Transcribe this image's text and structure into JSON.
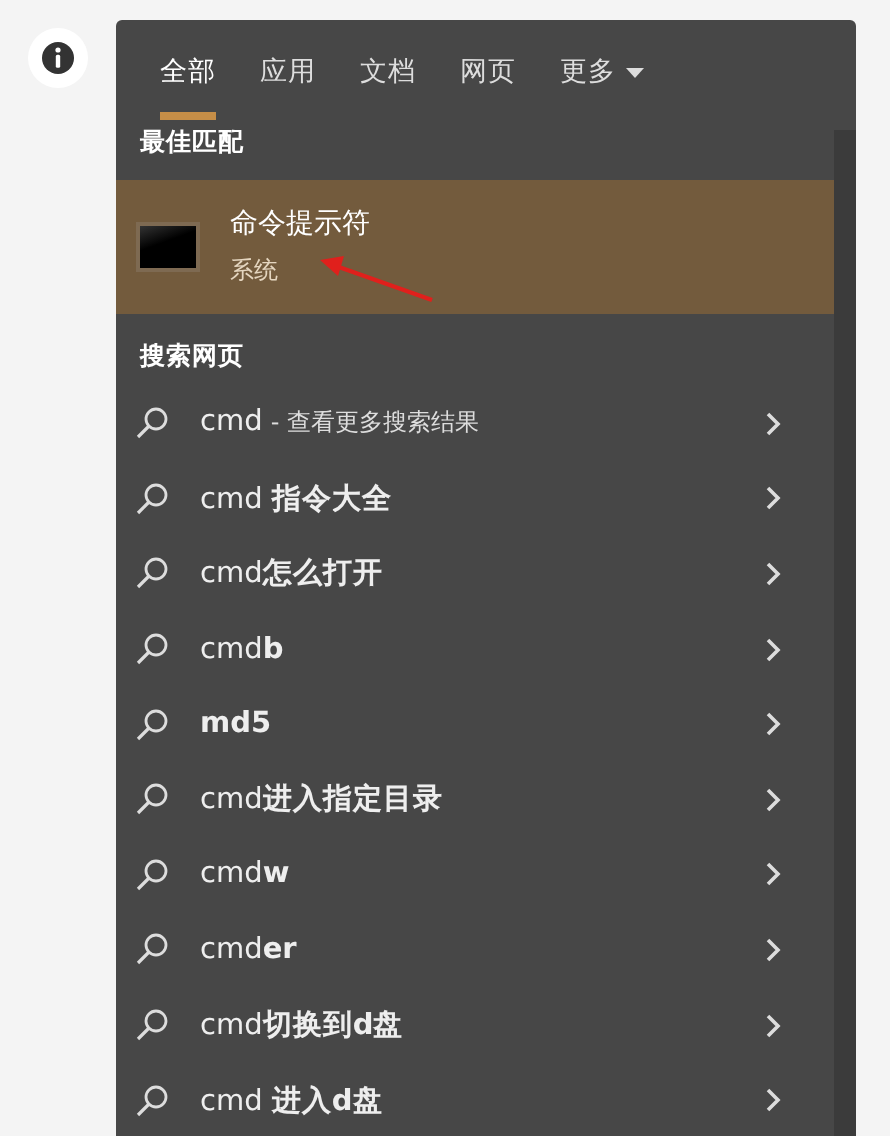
{
  "tabs": [
    {
      "label": "全部",
      "selected": true
    },
    {
      "label": "应用",
      "selected": false
    },
    {
      "label": "文档",
      "selected": false
    },
    {
      "label": "网页",
      "selected": false
    },
    {
      "label": "更多",
      "selected": false,
      "dropdown": true
    }
  ],
  "best_match": {
    "heading": "最佳匹配",
    "title": "命令提示符",
    "subtitle": "系统",
    "selected": true,
    "arrow_annotation": true
  },
  "web": {
    "heading": "搜索网页",
    "items": [
      {
        "kind": "more",
        "query": "cmd",
        "note": "- 查看更多搜索结果"
      },
      {
        "kind": "suggestion",
        "label": "cmd **指令大全**"
      },
      {
        "kind": "suggestion",
        "label": "cmd**怎么打开**"
      },
      {
        "kind": "suggestion",
        "label": "cmd**b**"
      },
      {
        "kind": "suggestion",
        "label": "**md5**"
      },
      {
        "kind": "suggestion",
        "label": "cmd**进入指定目录**"
      },
      {
        "kind": "suggestion",
        "label": "cmd**w**"
      },
      {
        "kind": "suggestion",
        "label": "cmd**er**"
      },
      {
        "kind": "suggestion",
        "label": "cmd**切换到d盘**"
      },
      {
        "kind": "suggestion",
        "label": "cmd **进入d盘**"
      }
    ]
  }
}
